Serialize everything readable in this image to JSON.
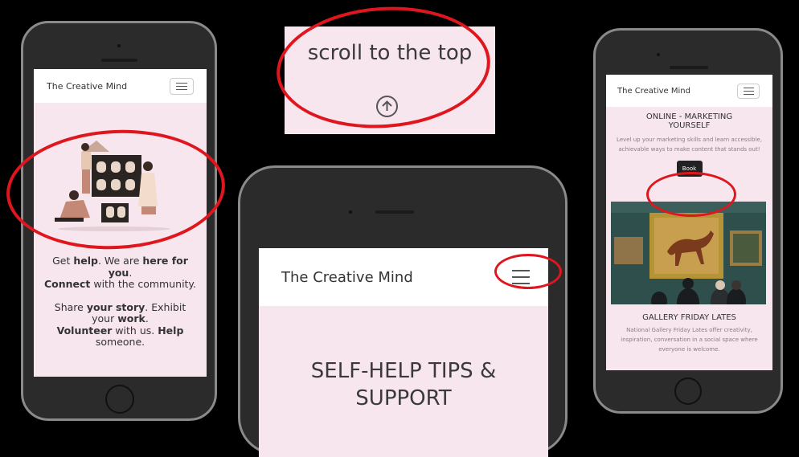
{
  "brand": "The Creative Mind",
  "left_screen": {
    "lines": [
      [
        {
          "t": "Get ",
          "b": false
        },
        {
          "t": "help",
          "b": true
        },
        {
          "t": ". We are ",
          "b": false
        },
        {
          "t": "here for you",
          "b": true
        },
        {
          "t": ".",
          "b": false
        }
      ],
      [
        {
          "t": "Connect",
          "b": true
        },
        {
          "t": " with the community.",
          "b": false
        }
      ],
      [
        {
          "t": "Share ",
          "b": false
        },
        {
          "t": "your story",
          "b": true
        },
        {
          "t": ". Exhibit your ",
          "b": false
        },
        {
          "t": "work",
          "b": true
        },
        {
          "t": ".",
          "b": false
        }
      ],
      [
        {
          "t": "Volunteer",
          "b": true
        },
        {
          "t": " with us. ",
          "b": false
        },
        {
          "t": "Help",
          "b": true
        },
        {
          "t": " someone.",
          "b": false
        }
      ]
    ]
  },
  "scroll_card": {
    "label": "scroll to the top"
  },
  "center_screen": {
    "heading_line1": "SELF-HELP TIPS &",
    "heading_line2": "SUPPORT"
  },
  "right_screen": {
    "event1_title_line1": "ONLINE - MARKETING",
    "event1_title_line2": "YOURSELF",
    "event1_desc": "Level up your marketing skills and learn accessible, achievable ways to make content that stands out!",
    "book_label": "Book",
    "event2_title": "GALLERY FRIDAY LATES",
    "event2_desc": "National Gallery Friday Lates offer creativity, inspiration, conversation in a social space where everyone is welcome."
  },
  "colors": {
    "background": "#000000",
    "screen_bg": "#f7e6ed",
    "highlight_ring": "#e0161f",
    "text": "#333333",
    "book_button": "#222222"
  }
}
